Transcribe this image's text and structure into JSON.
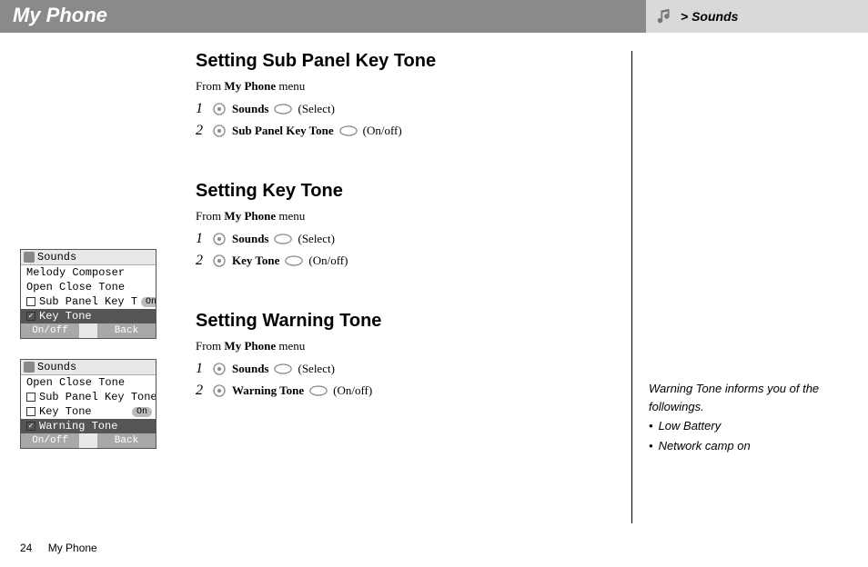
{
  "header": {
    "title": "My Phone",
    "breadcrumb_prefix": ">",
    "breadcrumb_label": "Sounds"
  },
  "sections": [
    {
      "heading": "Setting Sub Panel Key Tone",
      "from_prefix": "From ",
      "from_bold": "My Phone",
      "from_suffix": " menu",
      "steps": [
        {
          "num": "1",
          "label": "Sounds",
          "action": "(Select)"
        },
        {
          "num": "2",
          "label": "Sub Panel Key Tone",
          "action": "(On/off)"
        }
      ]
    },
    {
      "heading": "Setting Key Tone",
      "from_prefix": "From ",
      "from_bold": "My Phone",
      "from_suffix": " menu",
      "steps": [
        {
          "num": "1",
          "label": "Sounds",
          "action": "(Select)"
        },
        {
          "num": "2",
          "label": "Key Tone",
          "action": "(On/off)"
        }
      ]
    },
    {
      "heading": "Setting Warning Tone",
      "from_prefix": "From ",
      "from_bold": "My Phone",
      "from_suffix": " menu",
      "steps": [
        {
          "num": "1",
          "label": "Sounds",
          "action": "(Select)"
        },
        {
          "num": "2",
          "label": "Warning Tone",
          "action": "(On/off)"
        }
      ]
    }
  ],
  "phones": [
    {
      "title": "Sounds",
      "rows": [
        {
          "check": false,
          "checkbox": false,
          "label": "Melody Composer",
          "badge": ""
        },
        {
          "check": false,
          "checkbox": false,
          "label": "Open Close Tone",
          "badge": ""
        },
        {
          "check": false,
          "checkbox": true,
          "label": "Sub Panel Key T",
          "badge": "On"
        },
        {
          "check": true,
          "checkbox": true,
          "label": "Key Tone",
          "badge": "",
          "hl": true
        }
      ],
      "soft_left": "On/off",
      "soft_right": "Back"
    },
    {
      "title": "Sounds",
      "rows": [
        {
          "check": false,
          "checkbox": false,
          "label": "Open Close Tone",
          "badge": ""
        },
        {
          "check": false,
          "checkbox": true,
          "label": "Sub Panel Key Tone",
          "badge": ""
        },
        {
          "check": false,
          "checkbox": true,
          "label": "Key Tone",
          "badge": "On"
        },
        {
          "check": true,
          "checkbox": true,
          "label": "Warning Tone",
          "badge": "",
          "hl": true
        }
      ],
      "soft_left": "On/off",
      "soft_right": "Back"
    }
  ],
  "sidebar": {
    "intro": "Warning Tone informs you of the followings.",
    "bullets": [
      "Low Battery",
      "Network camp on"
    ]
  },
  "footer": {
    "page": "24",
    "label": "My Phone"
  }
}
